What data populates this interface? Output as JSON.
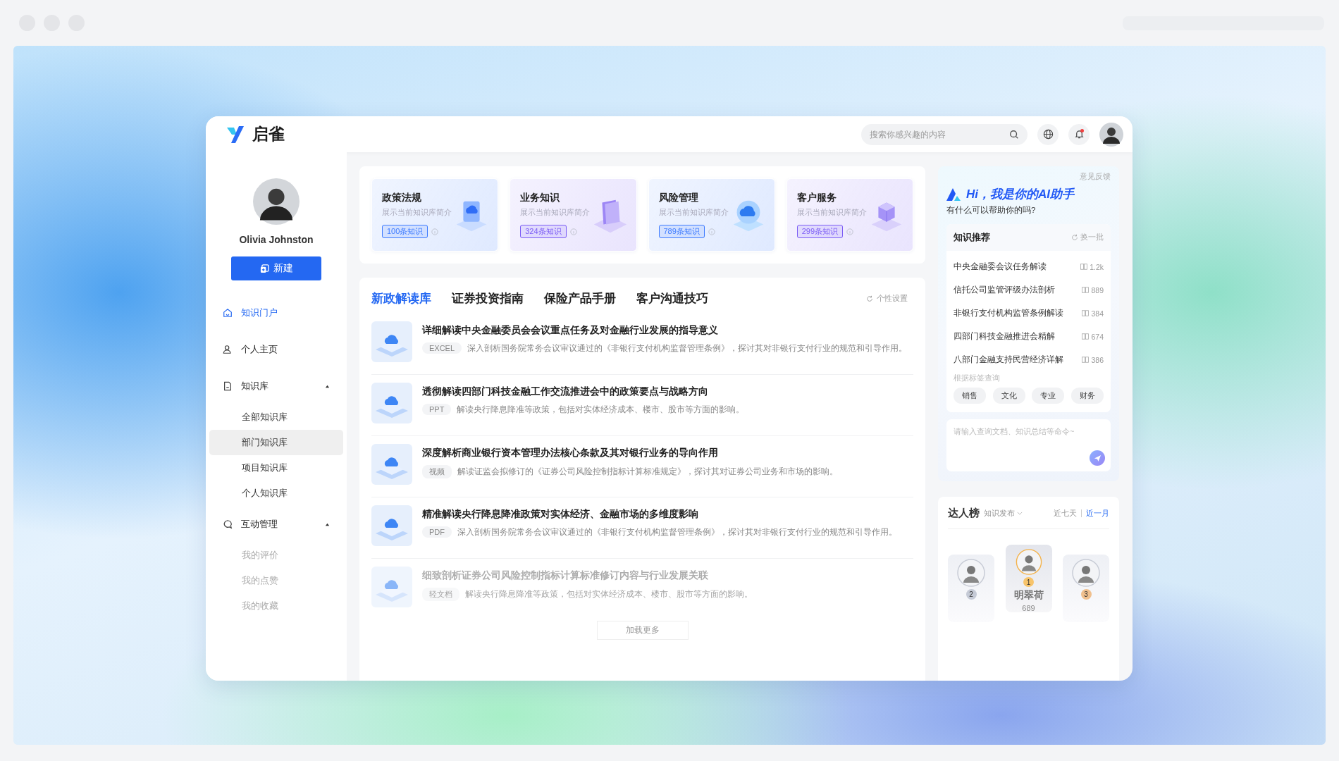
{
  "app": {
    "logo": "启雀"
  },
  "search": {
    "placeholder": "搜索你感兴趣的内容"
  },
  "notifications": {
    "unread": true
  },
  "user": {
    "name": "Olivia Johnston"
  },
  "new_button": "新建",
  "nav": [
    {
      "kind": "link",
      "label": "知识门户",
      "selected": true
    },
    {
      "kind": "link",
      "label": "个人主页",
      "selected": false
    },
    {
      "kind": "group",
      "label": "知识库",
      "selected": false,
      "expanded": true,
      "children": [
        {
          "label": "全部知识库",
          "selected": false,
          "muted": false
        },
        {
          "label": "部门知识库",
          "selected": true,
          "muted": false
        },
        {
          "label": "项目知识库",
          "selected": false,
          "muted": false
        },
        {
          "label": "个人知识库",
          "selected": false,
          "muted": false
        }
      ]
    },
    {
      "kind": "group",
      "label": "互动管理",
      "selected": false,
      "expanded": true,
      "children": [
        {
          "label": "我的评价",
          "selected": false,
          "muted": true
        },
        {
          "label": "我的点赞",
          "selected": false,
          "muted": true
        },
        {
          "label": "我的收藏",
          "selected": false,
          "muted": true
        }
      ]
    }
  ],
  "categories": [
    {
      "title": "政策法规",
      "description": "展示当前知识库简介",
      "count": "100条知识",
      "color": "#3d7bff",
      "kind": "screen"
    },
    {
      "title": "业务知识",
      "description": "展示当前知识库简介",
      "count": "324条知识",
      "color": "#7b5cf5",
      "kind": "book"
    },
    {
      "title": "风险管理",
      "description": "展示当前知识库简介",
      "count": "789条知识",
      "color": "#3d7bff",
      "kind": "cloud"
    },
    {
      "title": "客户服务",
      "description": "展示当前知识库简介",
      "count": "299条知识",
      "color": "#7b5cf5",
      "kind": "cubes"
    }
  ],
  "tabs": [
    {
      "label": "新政解读库",
      "selected": true
    },
    {
      "label": "证券投资指南",
      "selected": false
    },
    {
      "label": "保险产品手册",
      "selected": false
    },
    {
      "label": "客户沟通技巧",
      "selected": false
    }
  ],
  "settings_link": "个性设置",
  "articles": [
    {
      "title": "详细解读中央金融委员会会议重点任务及对金融行业发展的指导意义",
      "tag": "EXCEL",
      "description": "深入剖析国务院常务会议审议通过的《非银行支付机构监督管理条例》，探讨其对非银行支付行业的规范和引导作用。",
      "faded": false
    },
    {
      "title": "透彻解读四部门科技金融工作交流推进会中的政策要点与战略方向",
      "tag": "PPT",
      "description": "解读央行降息降准等政策，包括对实体经济成本、楼市、股市等方面的影响。",
      "faded": false
    },
    {
      "title": "深度解析商业银行资本管理办法核心条款及其对银行业务的导向作用",
      "tag": "视频",
      "description": "解读证监会拟修订的《证券公司风险控制指标计算标准规定》，探讨其对证券公司业务和市场的影响。",
      "faded": false
    },
    {
      "title": "精准解读央行降息降准政策对实体经济、金融市场的多维度影响",
      "tag": "PDF",
      "description": "深入剖析国务院常务会议审议通过的《非银行支付机构监督管理条例》，探讨其对非银行支付行业的规范和引导作用。",
      "faded": false
    },
    {
      "title": "细致剖析证券公司风险控制指标计算标准修订内容与行业发展关联",
      "tag": "轻文档",
      "description": "解读央行降息降准等政策，包括对实体经济成本、楼市、股市等方面的影响。",
      "faded": true
    }
  ],
  "load_more": "加载更多",
  "assistant": {
    "feedback": "意见反馈",
    "greeting": "Hi，我是你的AI助手",
    "subtitle": "有什么可以帮助你的吗?",
    "input_placeholder": "请输入查询文档、知识总结等命令~"
  },
  "recommend": {
    "title": "知识推荐",
    "refresh": "换一批",
    "items": [
      {
        "title": "中央金融委会议任务解读",
        "count": "1.2k"
      },
      {
        "title": "信托公司监管评级办法剖析",
        "count": "889"
      },
      {
        "title": "非银行支付机构监管条例解读",
        "count": "384"
      },
      {
        "title": "四部门科技金融推进会精解",
        "count": "674"
      },
      {
        "title": "八部门金融支持民营经济详解",
        "count": "386"
      }
    ],
    "tags_label": "根据标签查询",
    "tags": [
      "销售",
      "文化",
      "专业",
      "财务"
    ]
  },
  "leaderboard": {
    "title": "达人榜",
    "filter": "知识发布",
    "periods": [
      {
        "label": "近七天",
        "selected": false
      },
      {
        "label": "近一月",
        "selected": true
      }
    ],
    "podium": [
      {
        "rank": "2"
      },
      {
        "rank": "1",
        "name": "明翠荷",
        "count": "689"
      },
      {
        "rank": "3"
      }
    ]
  }
}
